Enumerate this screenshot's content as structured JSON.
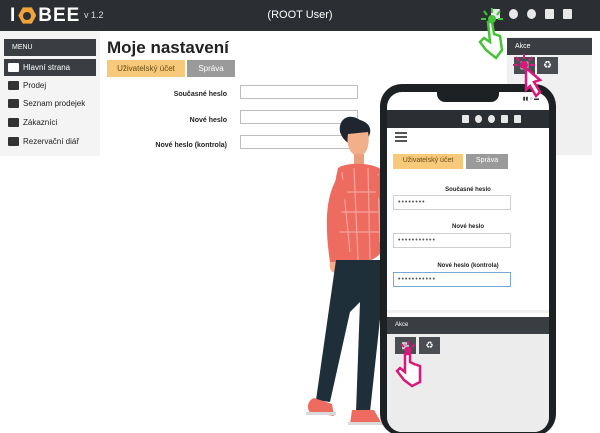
{
  "app": {
    "logo_letter": "I",
    "logo_word": "BEE",
    "version": "v 1.2",
    "user": "(ROOT User)"
  },
  "sidebar": {
    "menu_title": "MENU",
    "items": [
      {
        "label": "Hlavní strana",
        "icon": "signpost-icon",
        "active": true
      },
      {
        "label": "Prodej",
        "icon": "cart-icon",
        "active": false
      },
      {
        "label": "Seznam prodejek",
        "icon": "bag-icon",
        "active": false
      },
      {
        "label": "Zákazníci",
        "icon": "users-icon",
        "active": false
      },
      {
        "label": "Rezervační diář",
        "icon": "calendar-icon",
        "active": false
      }
    ]
  },
  "main": {
    "title": "Moje nastavení",
    "tabs": [
      "Uživatelský účet",
      "Správa"
    ],
    "fields": [
      {
        "label": "Současné heslo",
        "value": ""
      },
      {
        "label": "Nové heslo",
        "value": ""
      },
      {
        "label": "Nové heslo (kontrola)",
        "value": ""
      }
    ]
  },
  "actions": {
    "title": "Akce",
    "buttons": [
      "save-icon",
      "recycle-icon"
    ]
  },
  "phone": {
    "tabs": [
      "Uživatelský účet",
      "Správa"
    ],
    "fields": [
      {
        "label": "Současné heslo",
        "value": "••••••••"
      },
      {
        "label": "Nové heslo",
        "value": "•••••••••••"
      },
      {
        "label": "Nové heslo (kontrola)",
        "value": "•••••••••••"
      }
    ],
    "actions_title": "Akce"
  },
  "colors": {
    "topbar": "#2b2f33",
    "tab_active": "#f7c97a",
    "tab_inactive": "#9a9a9a",
    "cursor_green": "#45c23a",
    "cursor_pink": "#d8187a",
    "shirt": "#ee6b60",
    "pants": "#1f2f3a"
  }
}
